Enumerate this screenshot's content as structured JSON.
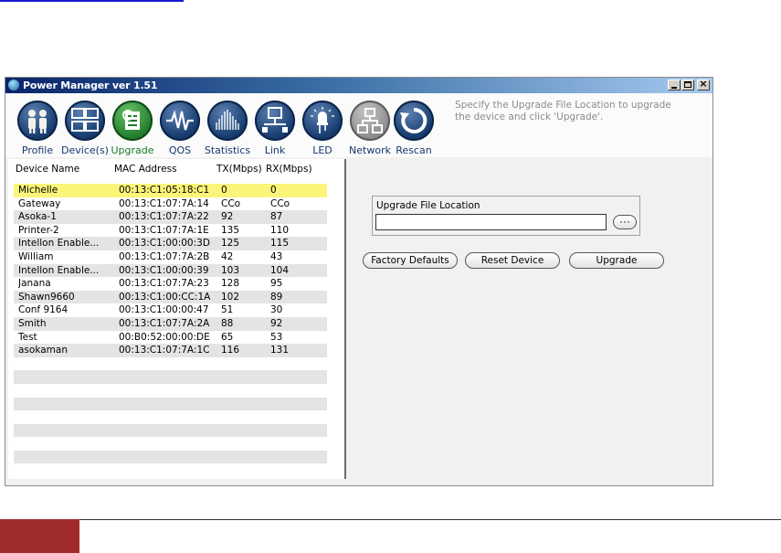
{
  "window": {
    "title": "Power Manager ver 1.51",
    "controls": {
      "minimize": "_",
      "maximize": "□",
      "close": "×"
    }
  },
  "toolbar": {
    "items": [
      {
        "label": "Profile",
        "icon": "people-icon"
      },
      {
        "label": "Device(s)",
        "icon": "computers-icon"
      },
      {
        "label": "Upgrade",
        "icon": "upgrade-icon"
      },
      {
        "label": "QOS",
        "icon": "waveform-icon"
      },
      {
        "label": "Statistics",
        "icon": "bars-icon"
      },
      {
        "label": "Link",
        "icon": "link-icon"
      },
      {
        "label": "LED",
        "icon": "led-icon"
      },
      {
        "label": "Network",
        "icon": "network-icon"
      },
      {
        "label": "Rescan",
        "icon": "refresh-icon"
      }
    ],
    "hint": "Specify the Upgrade File Location to upgrade the device and click 'Upgrade'."
  },
  "device_table": {
    "columns": [
      "Device Name",
      "MAC Address",
      "TX(Mbps)",
      "RX(Mbps)"
    ],
    "rows": [
      {
        "name": "Michelle",
        "mac": "00:13:C1:05:18:C1",
        "tx": "0",
        "rx": "0"
      },
      {
        "name": "Gateway",
        "mac": "00:13:C1:07:7A:14",
        "tx": "CCo",
        "rx": "CCo"
      },
      {
        "name": "Asoka-1",
        "mac": "00:13:C1:07:7A:22",
        "tx": "92",
        "rx": "87"
      },
      {
        "name": "Printer-2",
        "mac": "00:13:C1:07:7A:1E",
        "tx": "135",
        "rx": "110"
      },
      {
        "name": "Intellon Enable...",
        "mac": "00:13:C1:00:00:3D",
        "tx": "125",
        "rx": "115"
      },
      {
        "name": "William",
        "mac": "00:13:C1:07:7A:2B",
        "tx": "42",
        "rx": "43"
      },
      {
        "name": "Intellon Enable...",
        "mac": "00:13:C1:00:00:39",
        "tx": "103",
        "rx": "104"
      },
      {
        "name": "Janana",
        "mac": "00:13:C1:07:7A:23",
        "tx": "128",
        "rx": "95"
      },
      {
        "name": "Shawn9660",
        "mac": "00:13:C1:00:CC:1A",
        "tx": "102",
        "rx": "89"
      },
      {
        "name": "Conf 9164",
        "mac": "00:13:C1:00:00:47",
        "tx": "51",
        "rx": "30"
      },
      {
        "name": "Smith",
        "mac": "00:13:C1:07:7A:2A",
        "tx": "88",
        "rx": "92"
      },
      {
        "name": "Test",
        "mac": "00:B0:52:00:00:DE",
        "tx": "65",
        "rx": "53"
      },
      {
        "name": "asokaman",
        "mac": "00:13:C1:07:7A:1C",
        "tx": "116",
        "rx": "131"
      }
    ],
    "empty_rows": 8,
    "selected_row": "Michelle",
    "selected_color": "#fbf57a"
  },
  "upgrade_panel": {
    "group_label": "Upgrade File Location",
    "file_value": "",
    "browse_label": "···",
    "buttons": {
      "factory_defaults": "Factory Defaults",
      "reset_device": "Reset Device",
      "upgrade": "Upgrade"
    }
  },
  "colors": {
    "title_bar": "#0a246a",
    "icon_blue": "#173d70",
    "icon_green": "#1f7a2a",
    "footer_accent": "#a02b2c"
  }
}
